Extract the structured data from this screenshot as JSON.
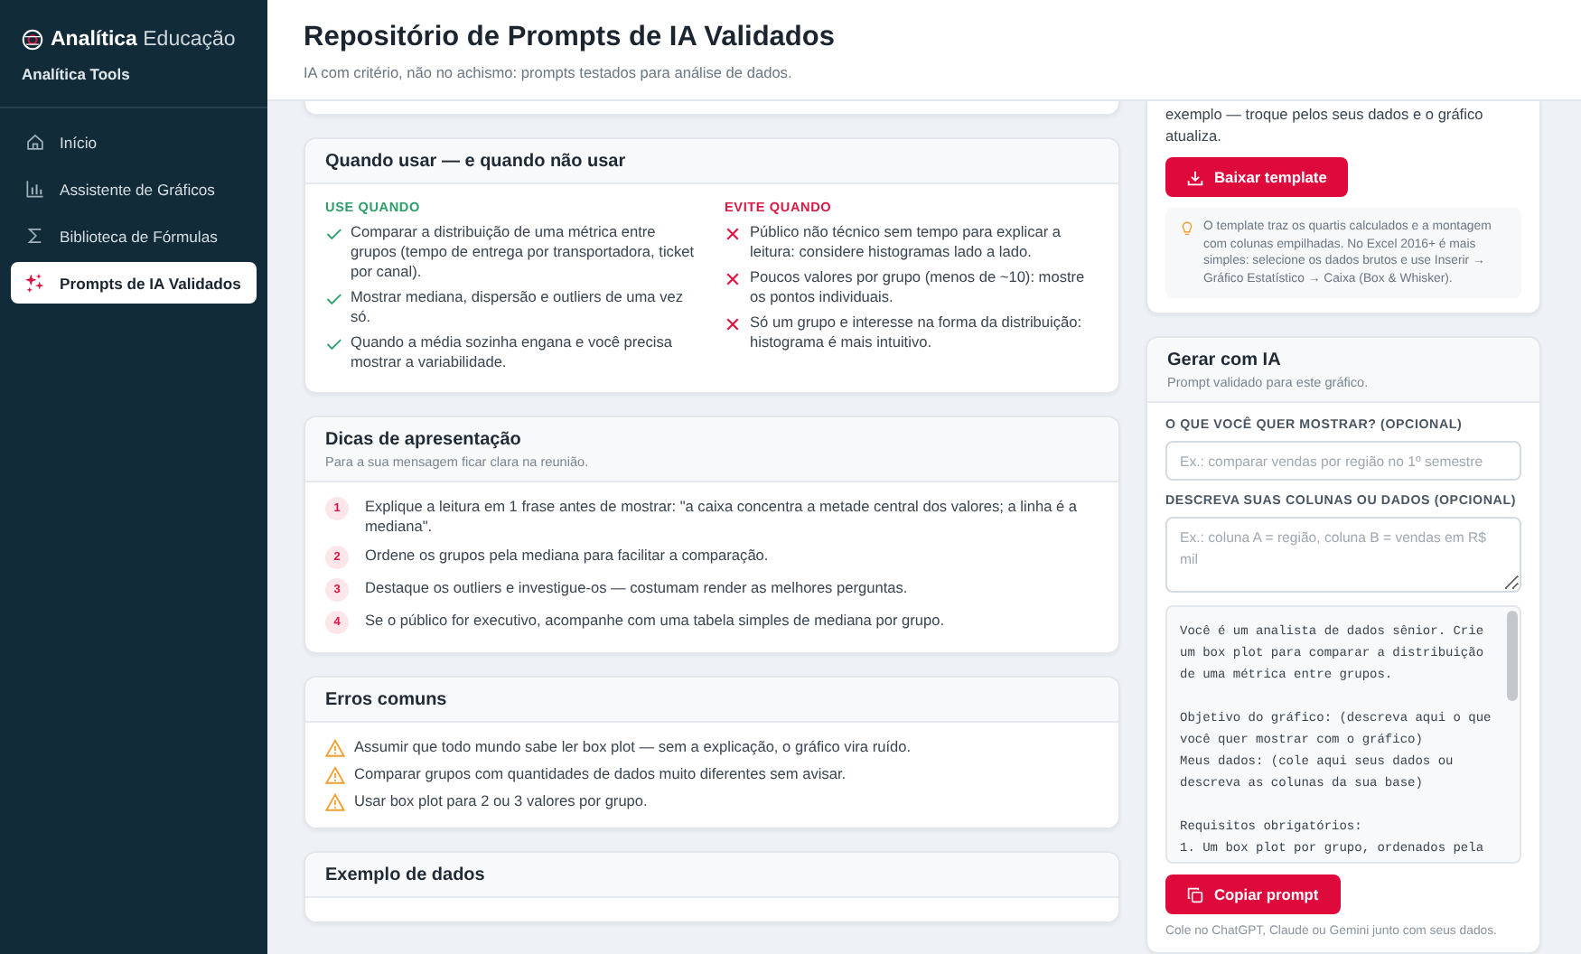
{
  "sidebar": {
    "brand_bold": "Analítica",
    "brand_light": "Educação",
    "subtitle": "Analítica Tools",
    "items": [
      {
        "label": "Início",
        "kind": "home",
        "selected": false
      },
      {
        "label": "Assistente de Gráficos",
        "kind": "chart",
        "selected": false
      },
      {
        "label": "Biblioteca de Fórmulas",
        "kind": "sigma",
        "selected": false
      },
      {
        "label": "Prompts de IA Validados",
        "kind": "sparkle",
        "selected": true
      }
    ]
  },
  "header": {
    "title": "Repositório de Prompts de IA Validados",
    "subtitle": "IA com critério, não no achismo: prompts testados para análise de dados."
  },
  "usage_card": {
    "title": "Quando usar — e quando não usar",
    "use": {
      "heading": "USE QUANDO",
      "items": [
        "Comparar a distribuição de uma métrica entre grupos (tempo de entrega por transportadora, ticket por canal).",
        "Mostrar mediana, dispersão e outliers de uma vez só.",
        "Quando a média sozinha engana e você precisa mostrar a variabilidade."
      ]
    },
    "avoid": {
      "heading": "EVITE QUANDO",
      "items": [
        "Público não técnico sem tempo para explicar a leitura: considere histogramas lado a lado.",
        "Poucos valores por grupo (menos de ~10): mostre os pontos individuais.",
        "Só um grupo e interesse na forma da distribuição: histograma é mais intuitivo."
      ]
    }
  },
  "tips_card": {
    "title": "Dicas de apresentação",
    "subtitle": "Para a sua mensagem ficar clara na reunião.",
    "items": [
      {
        "number": "1",
        "text": "Explique a leitura em 1 frase antes de mostrar: \"a caixa concentra a metade central dos valores; a linha é a mediana\"."
      },
      {
        "number": "2",
        "text": "Ordene os grupos pela mediana para facilitar a comparação."
      },
      {
        "number": "3",
        "text": "Destaque os outliers e investigue-os — costumam render as melhores perguntas."
      },
      {
        "number": "4",
        "text": "Se o público for executivo, acompanhe com uma tabela simples de mediana por grupo."
      }
    ]
  },
  "errors_card": {
    "title": "Erros comuns",
    "items": [
      "Assumir que todo mundo sabe ler box plot — sem a explicação, o gráfico vira ruído.",
      "Comparar grupos com quantidades de dados muito diferentes sem avisar.",
      "Usar box plot para 2 ou 3 valores por grupo."
    ]
  },
  "example_card": {
    "title": "Exemplo de dados"
  },
  "template_card": {
    "text": "exemplo — troque pelos seus dados e o gráfico atualiza.",
    "button": "Baixar template",
    "tip": "O template traz os quartis calculados e a montagem com colunas empilhadas. No Excel 2016+ é mais simples: selecione os dados brutos e use Inserir → Gráfico Estatístico → Caixa (Box & Whisker)."
  },
  "ai_card": {
    "title": "Gerar com IA",
    "subtitle": "Prompt validado para este gráfico.",
    "fields": [
      {
        "label": "O QUE VOCÊ QUER MOSTRAR? (OPCIONAL)",
        "placeholder": "Ex.: comparar vendas por região no 1º semestre",
        "kind": "input"
      },
      {
        "label": "DESCREVA SUAS COLUNAS OU DADOS (OPCIONAL)",
        "placeholder": "Ex.: coluna A = região, coluna B = vendas em R$ mil",
        "kind": "textarea"
      }
    ],
    "prompt": "Você é um analista de dados sênior. Crie\num box plot para comparar a distribuição\nde uma métrica entre grupos.\n\nObjetivo do gráfico: (descreva aqui o que\nvocê quer mostrar com o gráfico)\nMeus dados: (cole aqui seus dados ou\ndescreva as colunas da sua base)\n\nRequisitos obrigatórios:\n1. Um box plot por grupo, ordenados pela",
    "button": "Copiar prompt",
    "note": "Cole no ChatGPT, Claude ou Gemini junto com seus dados."
  }
}
